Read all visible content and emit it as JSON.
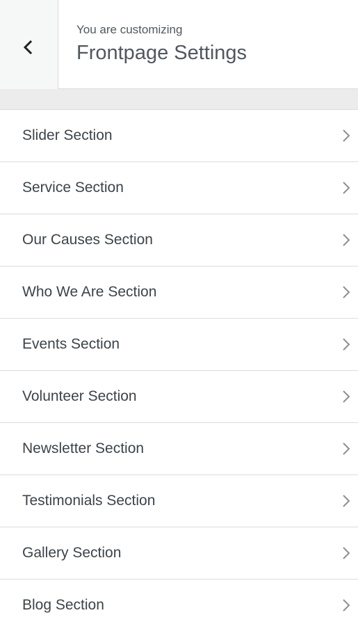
{
  "header": {
    "customizing_label": "You are customizing",
    "title": "Frontpage Settings",
    "back_icon": "chevron-left-icon"
  },
  "sections": [
    {
      "label": "Slider Section",
      "icon": "chevron-right-icon"
    },
    {
      "label": "Service Section",
      "icon": "chevron-right-icon"
    },
    {
      "label": "Our Causes Section",
      "icon": "chevron-right-icon"
    },
    {
      "label": "Who We Are Section",
      "icon": "chevron-right-icon"
    },
    {
      "label": "Events Section",
      "icon": "chevron-right-icon"
    },
    {
      "label": "Volunteer Section",
      "icon": "chevron-right-icon"
    },
    {
      "label": "Newsletter Section",
      "icon": "chevron-right-icon"
    },
    {
      "label": "Testimonials Section",
      "icon": "chevron-right-icon"
    },
    {
      "label": "Gallery Section",
      "icon": "chevron-right-icon"
    },
    {
      "label": "Blog Section",
      "icon": "chevron-right-icon"
    }
  ],
  "colors": {
    "panel_background": "#f1f1f1",
    "item_background": "#ffffff",
    "text": "#3c434a",
    "muted_text": "#50575e",
    "divider": "#dcdcde",
    "chevron": "#8c8f94"
  }
}
